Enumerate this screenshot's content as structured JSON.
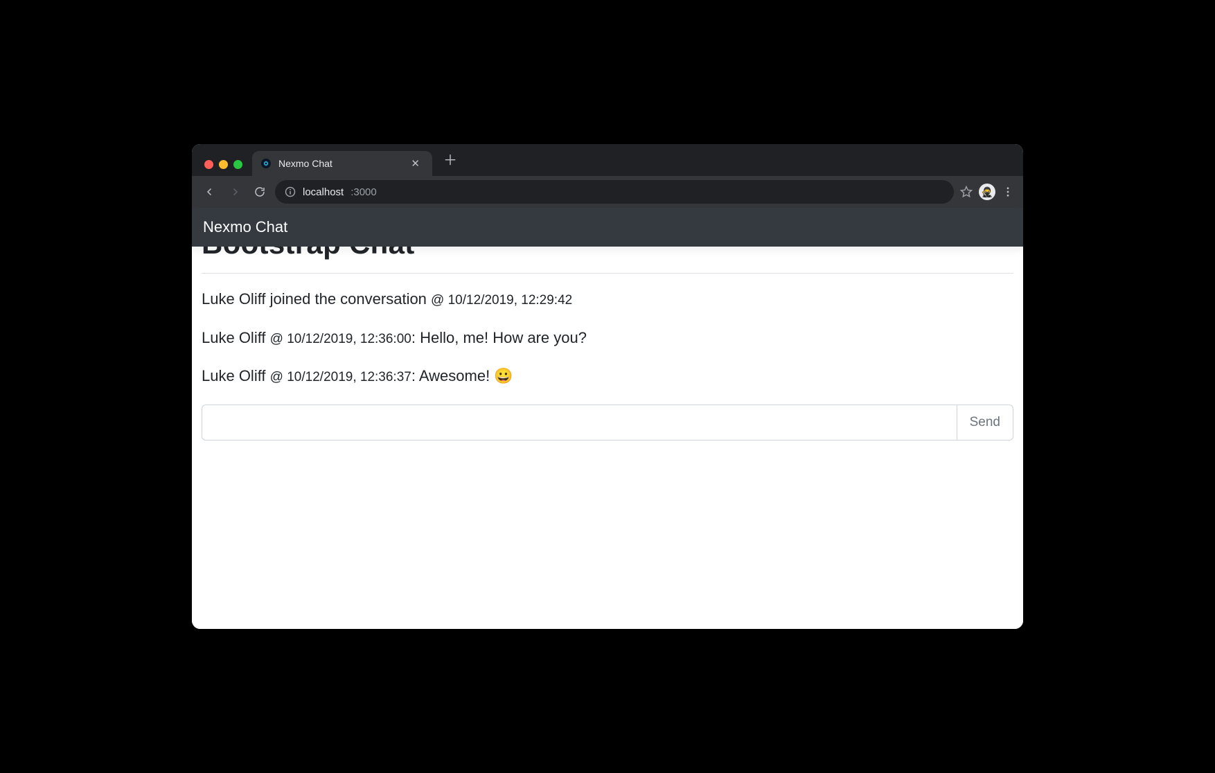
{
  "browser": {
    "tab_title": "Nexmo Chat",
    "url_host": "localhost",
    "url_port": ":3000"
  },
  "navbar": {
    "brand": "Nexmo Chat"
  },
  "page": {
    "clipped_heading": "Bootstrap Chat",
    "messages": [
      {
        "user": "Luke Oliff",
        "verb": " joined the conversation ",
        "timestamp": "@ 10/12/2019, 12:29:42",
        "text": ""
      },
      {
        "user": "Luke Oliff",
        "verb": " ",
        "timestamp": "@ 10/12/2019, 12:36:00",
        "text": ": Hello, me! How are you?"
      },
      {
        "user": "Luke Oliff",
        "verb": " ",
        "timestamp": "@ 10/12/2019, 12:36:37",
        "text": ": Awesome! 😀"
      }
    ],
    "compose": {
      "value": "",
      "send_label": "Send"
    }
  }
}
